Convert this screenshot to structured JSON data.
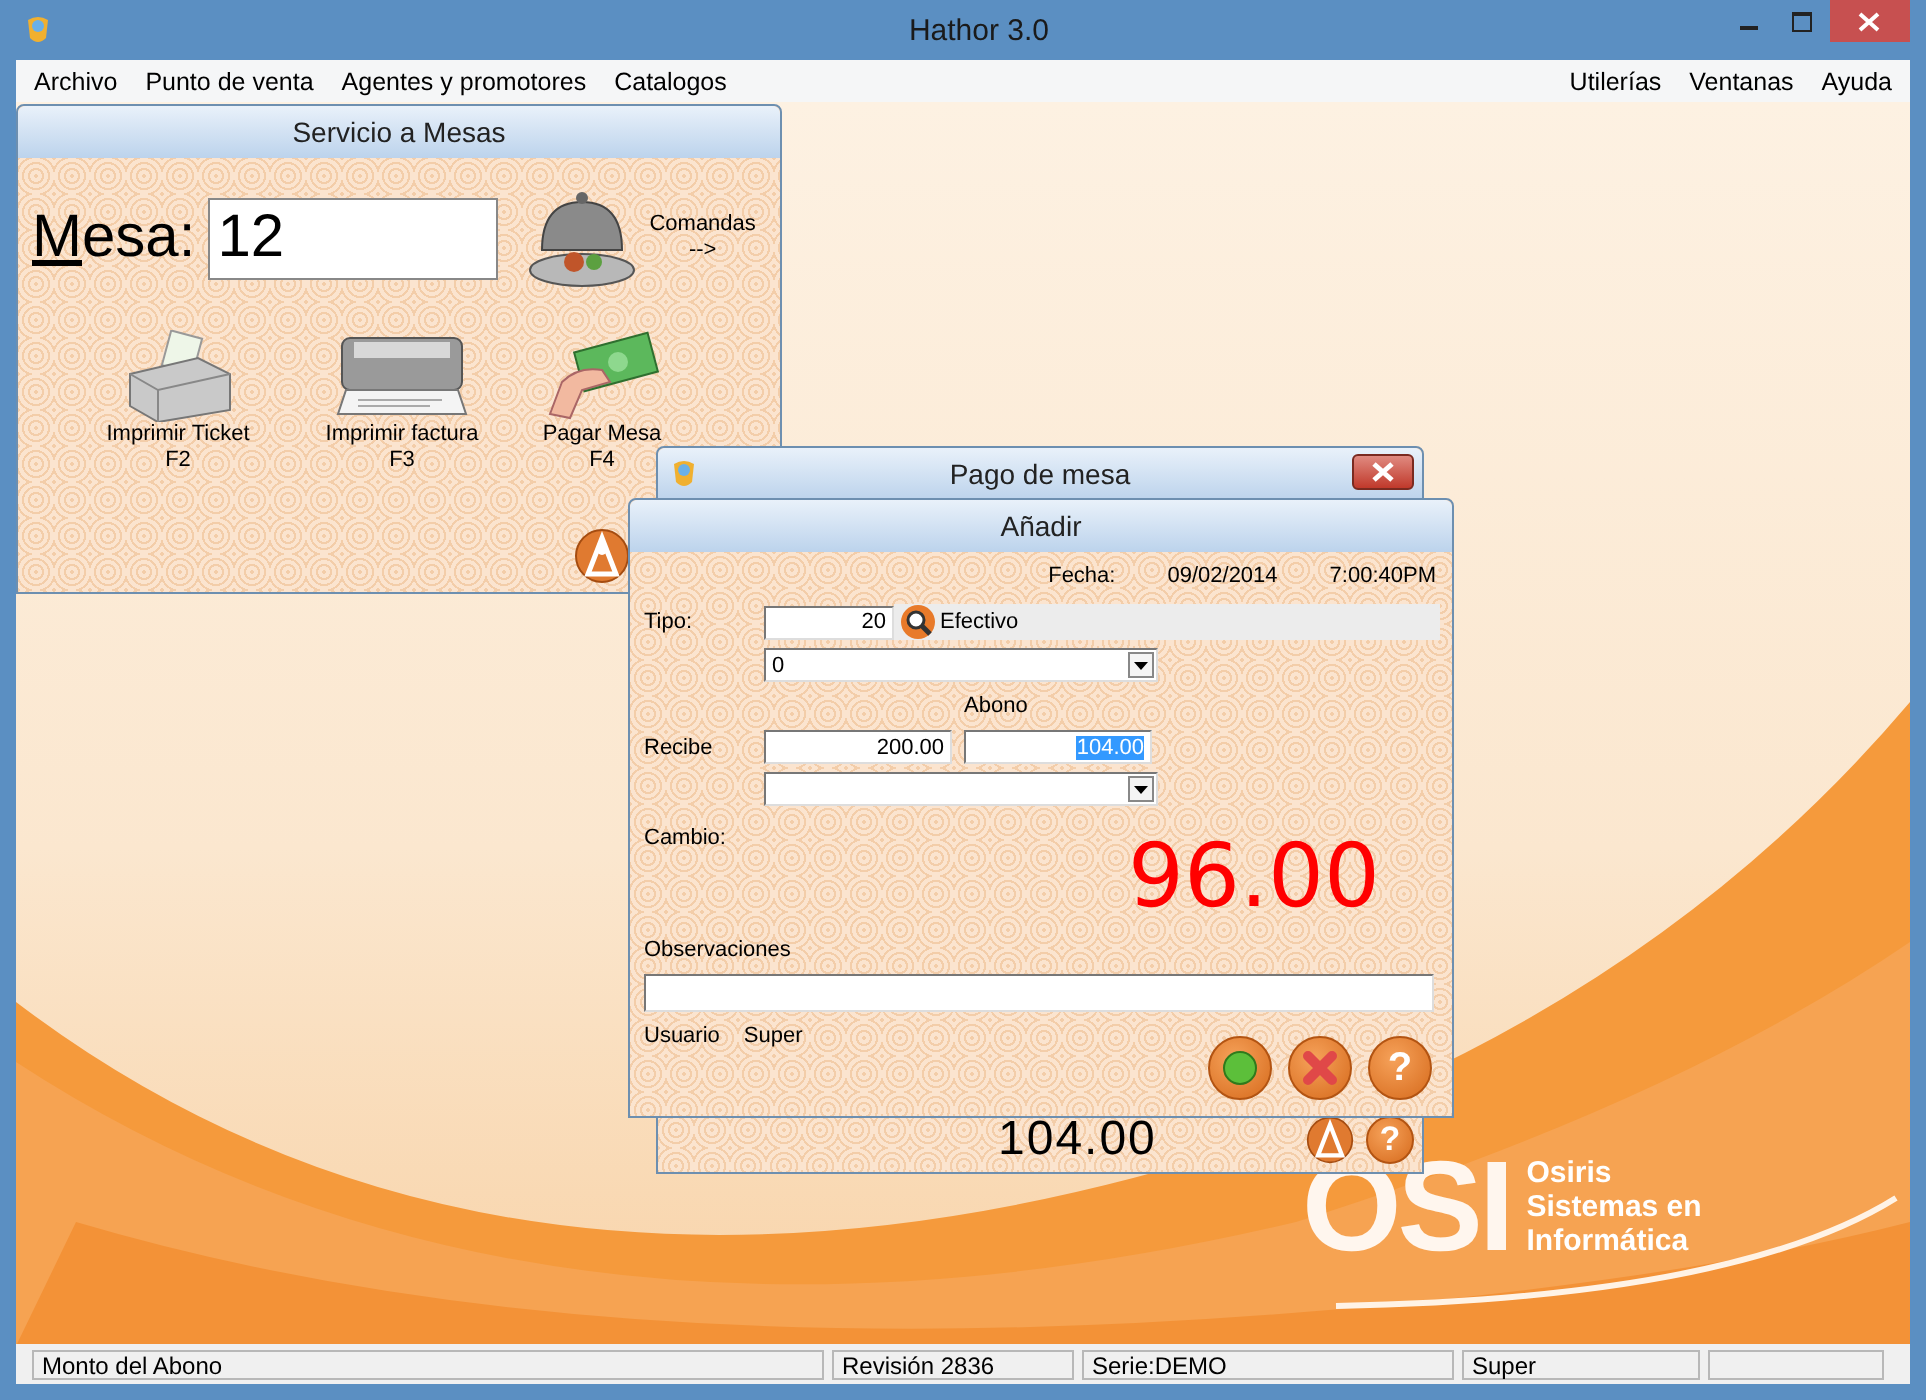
{
  "window": {
    "title": "Hathor 3.0"
  },
  "menu": {
    "left": [
      "Archivo",
      "Punto de venta",
      "Agentes y promotores",
      "Catalogos"
    ],
    "right": [
      "Utilerías",
      "Ventanas",
      "Ayuda"
    ]
  },
  "servicio": {
    "title": "Servicio a Mesas",
    "mesa_label": "Mesa:",
    "mesa_value": "12",
    "comandas": [
      "Comandas",
      "-->"
    ],
    "actions": [
      {
        "kind": "ticket",
        "label": "Imprimir Ticket",
        "key": "F2"
      },
      {
        "kind": "factura",
        "label": "Imprimir factura",
        "key": "F3"
      },
      {
        "kind": "pagar",
        "label": "Pagar Mesa",
        "key": "F4"
      }
    ]
  },
  "pago": {
    "title": "Pago de mesa",
    "amount": "104.00",
    "help": "?"
  },
  "anadir": {
    "title": "Añadir",
    "fecha_label": "Fecha:",
    "date": "09/02/2014",
    "time": "7:00:40PM",
    "tipo_label": "Tipo:",
    "tipo_value": "20",
    "tipo_name": "Efectivo",
    "combo_1": "0",
    "abono_label": "Abono",
    "recibe_label": "Recibe",
    "recibe_value": "200.00",
    "abono_value": "104.00",
    "abono_text_selected": true,
    "cambio_label": "Cambio:",
    "cambio_amount": "96.00",
    "observaciones_label": "Observaciones",
    "usuario_label": "Usuario",
    "usuario": "Super",
    "buttons": [
      {
        "kind": "ok"
      },
      {
        "kind": "cancel"
      },
      {
        "kind": "help",
        "label": "?"
      }
    ]
  },
  "logo": {
    "mark": "OSI",
    "lines": [
      "Osiris",
      "Sistemas en",
      "Informática"
    ]
  },
  "status_bar": [
    "Monto del Abono",
    "Revisión 2836",
    "Serie:DEMO",
    "Super"
  ]
}
